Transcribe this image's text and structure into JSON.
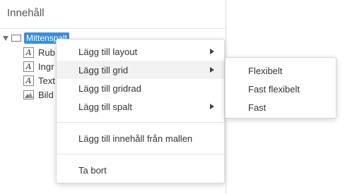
{
  "panel": {
    "title": "Innehåll"
  },
  "tree": {
    "root": {
      "label": "Mittenspalt",
      "icon": "container-icon"
    },
    "children": [
      {
        "label": "Rub",
        "icon": "text-a-icon"
      },
      {
        "label": "Ingr",
        "icon": "text-a-icon"
      },
      {
        "label": "Text",
        "icon": "text-a-icon"
      },
      {
        "label": "Bild",
        "icon": "image-icon"
      }
    ]
  },
  "context_menu": {
    "items": [
      {
        "label": "Lägg till layout",
        "has_submenu": true
      },
      {
        "label": "Lägg till grid",
        "has_submenu": true
      },
      {
        "label": "Lägg till gridrad",
        "has_submenu": false
      },
      {
        "label": "Lägg till spalt",
        "has_submenu": true
      },
      {
        "label": "Lägg till innehåll från mallen",
        "has_submenu": false
      },
      {
        "label": "Ta bort",
        "has_submenu": false
      }
    ],
    "active_item": "Lägg till grid"
  },
  "submenu": {
    "items": [
      {
        "label": "Flexibelt"
      },
      {
        "label": "Fast flexibelt"
      },
      {
        "label": "Fast"
      }
    ]
  },
  "colors": {
    "selection": "#3b8ed8",
    "hover": "#f2f2f2",
    "border": "#d8d8d8"
  }
}
